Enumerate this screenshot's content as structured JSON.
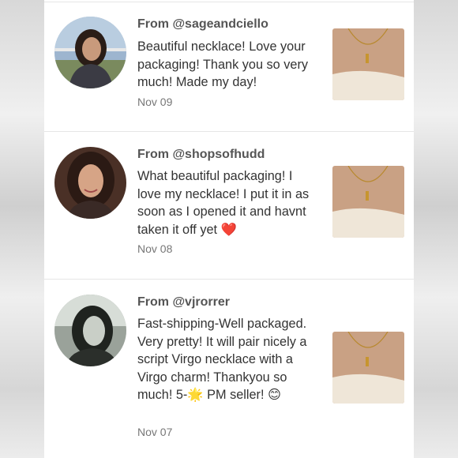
{
  "reviews": [
    {
      "from": "From @sageandciello",
      "text": "Beautiful necklace! Love your packaging! Thank you so very much! Made my day!",
      "date": "Nov 09"
    },
    {
      "from": "From @shopsofhudd",
      "text": "What beautiful packaging! I love my necklace! I put it in as soon as I opened it and havnt taken it off yet ❤️",
      "date": "Nov 08"
    },
    {
      "from": "From @vjrorrer",
      "text": "Fast-shipping-Well packaged. Very pretty! It will pair nicely a script Virgo necklace with a Virgo charm! Thankyou so much! 5-🌟 PM seller! 😊",
      "date": "Nov 07"
    }
  ]
}
